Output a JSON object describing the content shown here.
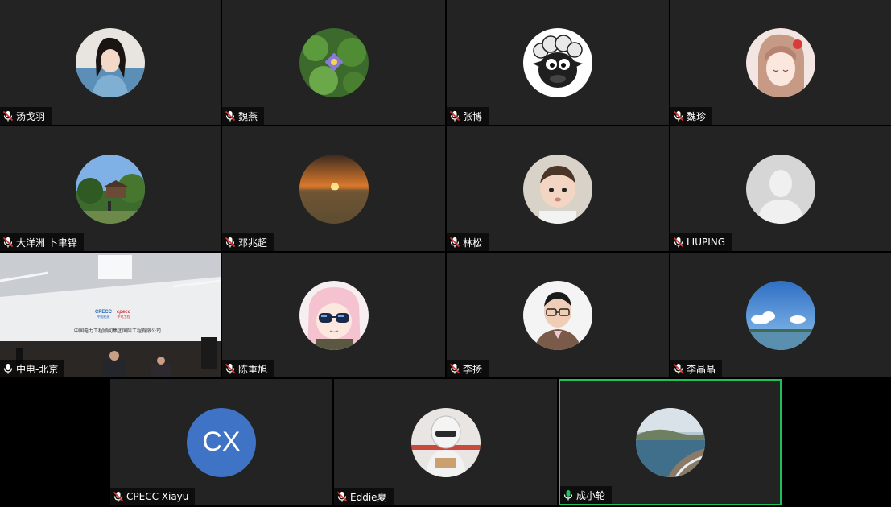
{
  "accent_active": "#1fbf5a",
  "muted_color": "#e0352e",
  "unmuted_color": "#21c25e",
  "participants": [
    {
      "name": "汤戈羽",
      "mic": "muted",
      "avatar": "woman-photo"
    },
    {
      "name": "魏燕",
      "mic": "muted",
      "avatar": "lotus-photo"
    },
    {
      "name": "张博",
      "mic": "muted",
      "avatar": "sheep-cartoon"
    },
    {
      "name": "魏珍",
      "mic": "muted",
      "avatar": "anime-girl"
    },
    {
      "name": "大洋洲 卜聿铎",
      "mic": "muted",
      "avatar": "garden-photo"
    },
    {
      "name": "邓兆超",
      "mic": "muted",
      "avatar": "sunset-photo"
    },
    {
      "name": "林松",
      "mic": "muted",
      "avatar": "baby-photo"
    },
    {
      "name": "LIUPING",
      "mic": "muted",
      "avatar": "default-user"
    },
    {
      "name": "中电-北京",
      "mic": "unmuted-white",
      "avatar": "meeting-room-video"
    },
    {
      "name": "陈重旭",
      "mic": "muted",
      "avatar": "anime-sunglasses"
    },
    {
      "name": "李扬",
      "mic": "muted",
      "avatar": "man-glasses-photo"
    },
    {
      "name": "李晶晶",
      "mic": "muted",
      "avatar": "sky-sea-photo"
    },
    {
      "name": "CPECC Xiayu",
      "mic": "muted",
      "avatar": "initials",
      "initials": "CX",
      "initials_color": "#3f73c6"
    },
    {
      "name": "Eddie夏",
      "mic": "muted",
      "avatar": "helmet-photo"
    },
    {
      "name": "成小轮",
      "mic": "active",
      "avatar": "coast-photo"
    }
  ],
  "video_room": {
    "logo_left": "CPECC",
    "logo_left_sub": "中国能建",
    "logo_right": "cpecc",
    "logo_right_sub": "中电工程",
    "banner": "中国电力工程顾问集团国际工程有限公司"
  }
}
